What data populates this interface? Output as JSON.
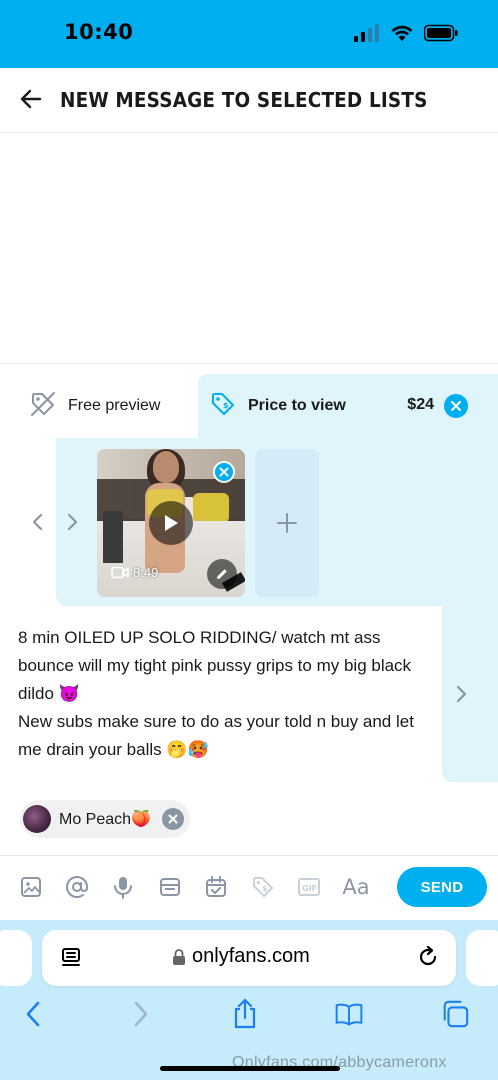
{
  "status_bar": {
    "time": "10:40",
    "signal_icon": "cellular-signal-icon",
    "wifi_icon": "wifi-icon",
    "battery_icon": "battery-icon"
  },
  "header": {
    "back_icon": "arrow-left-icon",
    "title": "NEW MESSAGE TO SELECTED LISTS"
  },
  "price_tabs": {
    "free_preview": {
      "icon": "tag-off-icon",
      "label": "Free preview"
    },
    "price_to_view": {
      "icon": "price-tag-icon",
      "label": "Price to view",
      "price": "$24",
      "clear_icon": "close-icon"
    }
  },
  "media": {
    "prev_icon": "chevron-left-icon",
    "next_icon": "chevron-right-icon",
    "items": [
      {
        "type": "video",
        "duration": "8:49",
        "play_icon": "play-icon",
        "remove_icon": "close-icon",
        "edit_icon": "pencil-icon",
        "video_icon": "video-camera-icon"
      }
    ],
    "add_icon": "plus-icon"
  },
  "message": {
    "text": "8 min OILED UP SOLO RIDDING/ watch mt ass bounce will my tight pink pussy grips to my big black dildo 😈\nNew subs make sure to do as your told n buy and let me drain your balls 🤭🥵",
    "next_icon": "chevron-right-icon"
  },
  "recipients": [
    {
      "name": "Mo Peach🍑",
      "remove_icon": "close-icon"
    }
  ],
  "toolbar": {
    "tools": [
      "image-icon",
      "at-sign-icon",
      "microphone-icon",
      "vault-icon",
      "calendar-icon",
      "price-tag-icon",
      "gif-icon"
    ],
    "text_format_label": "Aa",
    "send_label": "SEND"
  },
  "browser": {
    "url": "onlyfans.com",
    "reader_icon": "reader-icon",
    "lock_icon": "lock-icon",
    "reload_icon": "reload-icon",
    "nav": [
      "back-icon",
      "forward-icon",
      "share-icon",
      "bookmarks-icon",
      "tabs-icon"
    ],
    "watermark": "Onlyfans.com/abbycameronx"
  },
  "colors": {
    "accent": "#00aff0",
    "panel": "#e0f4fc",
    "browser_bg": "#c6ebfb",
    "muted_icon": "#8a96a3"
  }
}
